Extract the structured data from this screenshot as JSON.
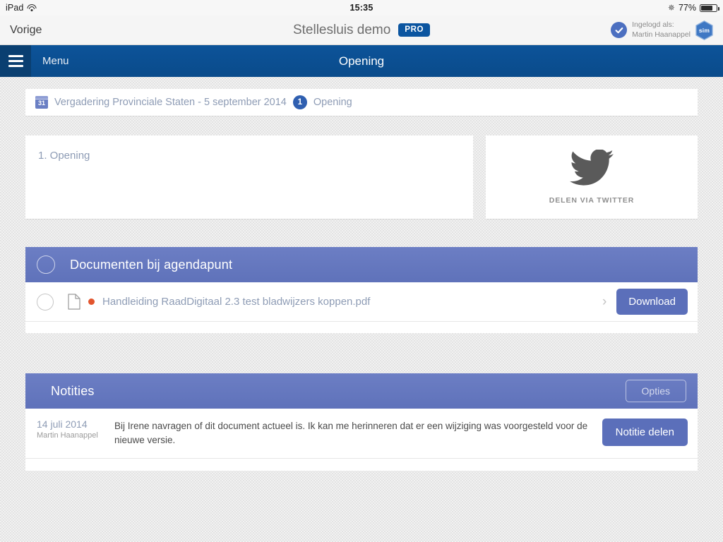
{
  "statusbar": {
    "device": "iPad",
    "wifi_icon": "wifi-icon",
    "time": "15:35",
    "bluetooth_icon": "bluetooth-icon",
    "battery_percent": "77%"
  },
  "appbar": {
    "back_label": "Vorige",
    "app_title": "Stellesluis demo",
    "pro_badge": "PRO",
    "check_icon": "check-circle-icon",
    "logged_in_label": "Ingelogd als:",
    "logged_in_user": "Martin Haanappel",
    "sim_logo": "sim"
  },
  "navbar": {
    "menu_icon": "hamburger-icon",
    "menu_label": "Menu",
    "title": "Opening",
    "color": "#0b5098"
  },
  "breadcrumb": {
    "calendar_icon_day": "31",
    "meeting": "Vergadering Provinciale Staten - 5 september 2014",
    "badge": "1",
    "current": "Opening"
  },
  "agenda": {
    "title": "1. Opening"
  },
  "twitter": {
    "icon": "twitter-bird-icon",
    "label": "DELEN VIA TWITTER"
  },
  "documents_panel": {
    "title": "Documenten bij agendapunt",
    "select_all_icon": "circle-checkbox-icon",
    "accent_color": "#6578be",
    "rows": [
      {
        "checkbox_icon": "circle-checkbox-icon",
        "file_icon": "document-icon",
        "unread_dot": "unread-dot",
        "name": "Handleiding RaadDigitaal 2.3 test bladwijzers koppen.pdf",
        "chevron_icon": "chevron-right-icon",
        "download_label": "Download"
      }
    ]
  },
  "notes_panel": {
    "title": "Notities",
    "options_label": "Opties",
    "accent_color": "#6578be",
    "notes": [
      {
        "date": "14 juli 2014",
        "author": "Martin Haanappel",
        "text": "Bij Irene navragen of dit document actueel is. Ik kan me herinneren dat er een wijziging was voorgesteld voor de nieuwe versie.",
        "share_label": "Notitie delen"
      }
    ]
  }
}
